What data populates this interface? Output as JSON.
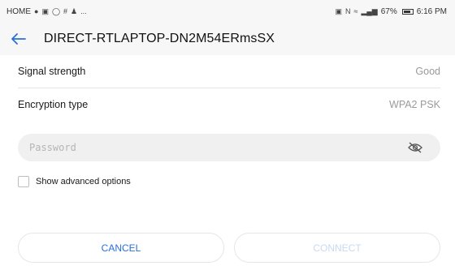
{
  "status_bar": {
    "carrier": "HOME",
    "notification_icons": [
      "circle-icon",
      "image-icon",
      "gallery-icon",
      "hash-icon",
      "person-icon",
      "more-icon"
    ],
    "more_text": "...",
    "battery": "67%",
    "time": "6:16 PM"
  },
  "header": {
    "title": "DIRECT-RTLAPTOP-DN2M54ERmsSX"
  },
  "details": [
    {
      "label": "Signal strength",
      "value": "Good"
    },
    {
      "label": "Encryption type",
      "value": "WPA2 PSK"
    }
  ],
  "password": {
    "placeholder": "Password",
    "value": ""
  },
  "advanced": {
    "label": "Show advanced options",
    "checked": false
  },
  "buttons": {
    "cancel_label": "CANCEL",
    "connect_label": "CONNECT"
  },
  "colors": {
    "accent": "#2a6fdb",
    "disabled_accent": "#c8d9f2",
    "field_bg": "#f0f0f0"
  }
}
